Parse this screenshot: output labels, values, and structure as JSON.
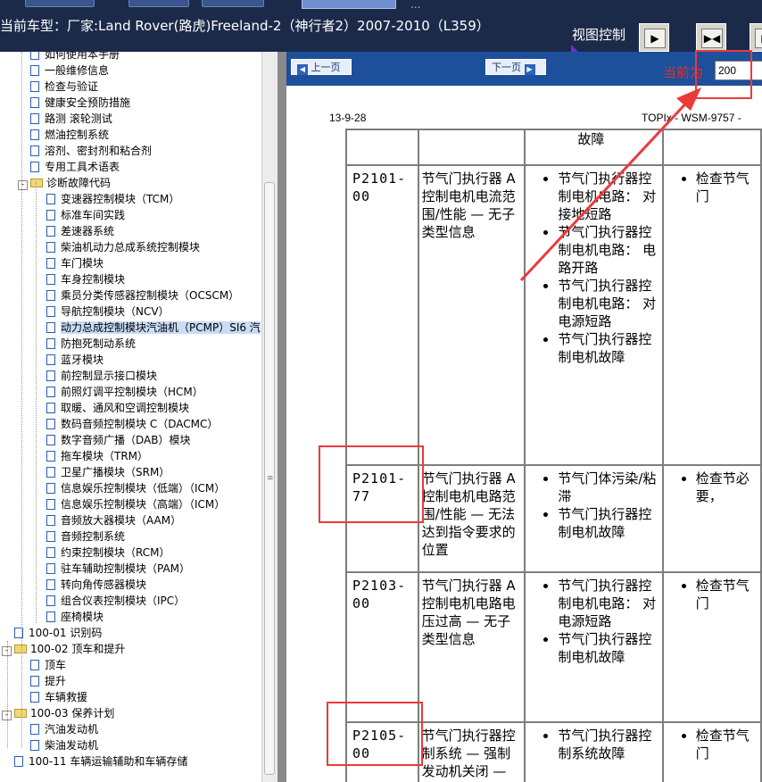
{
  "header": {
    "vehicle_title": "当前车型：厂家:Land Rover(路虎)Freeland-2（神行者2）2007-2010（L359）",
    "view_control_label": "视图控制",
    "top_dots": "...",
    "view_buttons": {
      "next_page": "▶",
      "fit": "▶◀",
      "full": "▶"
    }
  },
  "tree": {
    "items": [
      {
        "label": "如何使用本手册"
      },
      {
        "label": "一般维修信息"
      },
      {
        "label": "检查与验证"
      },
      {
        "label": "健康安全预防措施"
      },
      {
        "label": "路测 滚轮测试"
      },
      {
        "label": "燃油控制系统"
      },
      {
        "label": "溶剂、密封剂和粘合剂"
      },
      {
        "label": "专用工具术语表"
      },
      {
        "label": "诊断故障代码",
        "toggle": "-"
      },
      {
        "label": "变速器控制模块（TCM）"
      },
      {
        "label": "标准车间实践"
      },
      {
        "label": "差速器系统"
      },
      {
        "label": "柴油机动力总成系统控制模块"
      },
      {
        "label": "车门模块"
      },
      {
        "label": "车身控制模块"
      },
      {
        "label": "乘员分类传感器控制模块（OCSCM）"
      },
      {
        "label": "导航控制模块（NCV）"
      },
      {
        "label": "动力总成控制模块汽油机（PCMP）SI6 汽"
      },
      {
        "label": "防抱死制动系统"
      },
      {
        "label": "蓝牙模块"
      },
      {
        "label": "前控制显示接口模块"
      },
      {
        "label": "前照灯调平控制模块（HCM）"
      },
      {
        "label": "取暖、通风和空调控制模块"
      },
      {
        "label": "数码音频控制模块 C（DACMC）"
      },
      {
        "label": "数字音频广播（DAB）模块"
      },
      {
        "label": "拖车模块（TRM）"
      },
      {
        "label": "卫星广播模块（SRM）"
      },
      {
        "label": "信息娱乐控制模块（低端）（ICM）"
      },
      {
        "label": "信息娱乐控制模块（高端）（ICM）"
      },
      {
        "label": "音频放大器模块（AAM）"
      },
      {
        "label": "音频控制系统"
      },
      {
        "label": "约束控制模块（RCM）"
      },
      {
        "label": "驻车辅助控制模块（PAM）"
      },
      {
        "label": "转向角传感器模块"
      },
      {
        "label": "组合仪表控制模块（IPC）"
      },
      {
        "label": "座椅模块"
      },
      {
        "label": "100-01 识别码"
      },
      {
        "label": "100-02 顶车和提升",
        "toggle": "-"
      },
      {
        "label": "顶车"
      },
      {
        "label": "提升"
      },
      {
        "label": "车辆救援"
      },
      {
        "label": "100-03 保养计划",
        "toggle": "-"
      },
      {
        "label": "汽油发动机"
      },
      {
        "label": "柴油发动机"
      },
      {
        "label": "100-11 车辆运输辅助和车辆存储"
      }
    ]
  },
  "nav": {
    "prev_label": "上一页",
    "next_label": "下一页",
    "current_label": "当前为",
    "page_value": "200"
  },
  "doc": {
    "date": "13-9-28",
    "id": "TOPIx - WSM-9757 -"
  },
  "table": {
    "partial_top_cause": "故障",
    "rows": [
      {
        "code": "P2101-00",
        "desc": "节气门执行器 A 控制电机电流范围/性能 — 无子类型信息",
        "causes": [
          "节气门执行器控制电机电路： 对接地短路",
          "节气门执行器控制电机电路： 电路开路",
          "节气门执行器控制电机电路： 对电源短路",
          "节气门执行器控制电机故障"
        ],
        "actions": [
          "检查节气门"
        ]
      },
      {
        "code": "P2101-77",
        "desc": "节气门执行器 A 控制电机电路范围/性能 — 无法达到指令要求的位置",
        "causes": [
          "节气门体污染/粘滞",
          "节气门执行器控制电机故障"
        ],
        "actions": [
          "检查节必要，"
        ]
      },
      {
        "code": "P2103-00",
        "desc": "节气门执行器 A 控制电机电路电压过高 — 无子类型信息",
        "causes": [
          "节气门执行器控制电机电路： 对电源短路",
          "节气门执行器控制电机故障"
        ],
        "actions": [
          "检查节气门"
        ]
      },
      {
        "code": "P2105-00",
        "desc": "节气门执行器控制系统 — 强制发动机关闭 — 无子类型信",
        "causes": [
          "节气门执行器控制系统故障"
        ],
        "actions": [
          "检查节气门"
        ]
      }
    ]
  },
  "colors": {
    "header_bg": "#1c2a4a",
    "nav_bar": "#1d4f9a",
    "annotation_red": "#ec3a3a",
    "selected_item": "#c8dcf4"
  }
}
